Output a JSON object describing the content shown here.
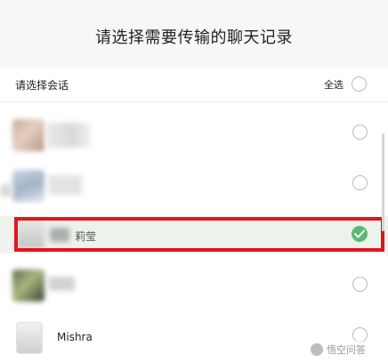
{
  "header": {
    "title": "请选择需要传输的聊天记录"
  },
  "section": {
    "label": "请选择会话",
    "select_all": "全选"
  },
  "conversations": [
    {
      "name": "",
      "selected": false
    },
    {
      "name": "",
      "selected": false
    },
    {
      "name": "莉莹",
      "selected": true
    },
    {
      "name": "",
      "selected": false
    },
    {
      "name": "Mishra",
      "selected": false
    }
  ],
  "watermark": {
    "text": "悟空问答"
  },
  "colors": {
    "check": "#2fa74a",
    "highlight": "#e4141f"
  }
}
